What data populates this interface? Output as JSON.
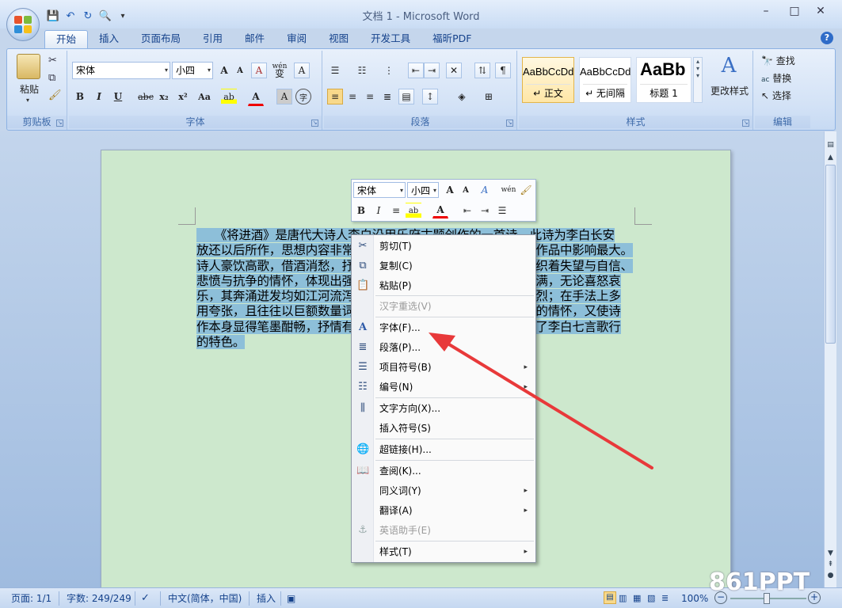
{
  "window": {
    "title": "文档 1 - Microsoft Word",
    "minimize": "–",
    "maximize": "□",
    "close": "✕"
  },
  "qat": {
    "save": "💾",
    "undo": "↶",
    "redo": "↻",
    "preview": "🔍",
    "customize": "▾"
  },
  "tabs": [
    "开始",
    "插入",
    "页面布局",
    "引用",
    "邮件",
    "审阅",
    "视图",
    "开发工具",
    "福昕PDF"
  ],
  "help": "?",
  "ribbon": {
    "clipboard": {
      "label": "剪贴板",
      "paste": "粘贴"
    },
    "font": {
      "label": "字体",
      "font_name": "宋体",
      "font_size": "小四",
      "bold": "B",
      "italic": "I",
      "underline": "U",
      "strike": "abc",
      "sub": "x₂",
      "sup": "x²",
      "case": "Aa",
      "highlight": "ab",
      "color": "A",
      "grow": "A",
      "shrink": "A",
      "clear": "A",
      "phonetic": "wén",
      "phonetic2": "变",
      "border": "A",
      "enclose": "字"
    },
    "paragraph": {
      "label": "段落"
    },
    "styles": {
      "label": "样式",
      "items": [
        {
          "preview": "AaBbCcDd",
          "name": "↵ 正文"
        },
        {
          "preview": "AaBbCcDd",
          "name": "↵ 无间隔"
        },
        {
          "preview": "AaBb",
          "name": "标题 1"
        }
      ],
      "change": "更改样式"
    },
    "editing": {
      "label": "编辑",
      "find": "查找",
      "replace": "替换",
      "select": "选择"
    }
  },
  "document": {
    "lines": [
      "　　《将进酒》是唐代大诗人李白沿用乐府古题创作的一首诗。此诗为李白长安",
      "放还以后所作，思想内容非常深沉，艺术表现非常成熟，在同类作品中影响最大。",
      "诗人豪饮高歌，借酒消愁，抒发了忧愤深广的人生感慨。诗中交织着失望与自信、",
      "悲愤与抗争的情怀，体现出强烈的豪纵狂放的个性。全诗情感饱满，无论喜怒哀",
      "乐，其奔涌迸发均如江河流泻，不可遏止，且起伏跌宕，变化剧烈；在手法上多",
      "用夸张，且往往以巨额数量词进行修饰，既表现出诗人豪迈洒脱的情怀，又使诗",
      "作本身显得笔墨酣畅，抒情有力；在结构上大开大阖，充分体现了李白七言歌行",
      "的特色。"
    ]
  },
  "mini_toolbar": {
    "font_name": "宋体",
    "font_size": "小四",
    "bold": "B",
    "italic": "I",
    "color": "A"
  },
  "context_menu": {
    "items": [
      {
        "label": "剪切(T)",
        "icon": "scissors-icon",
        "glyph": "✂",
        "disabled": false,
        "submenu": false
      },
      {
        "label": "复制(C)",
        "icon": "copy-icon",
        "glyph": "⧉",
        "disabled": false,
        "submenu": false
      },
      {
        "label": "粘贴(P)",
        "icon": "paste-icon",
        "glyph": "📋",
        "disabled": false,
        "submenu": false
      },
      {
        "label": "汉字重选(V)",
        "icon": "",
        "glyph": "",
        "disabled": true,
        "submenu": false
      },
      {
        "label": "字体(F)...",
        "icon": "font-icon",
        "glyph": "A",
        "disabled": false,
        "submenu": false
      },
      {
        "label": "段落(P)...",
        "icon": "paragraph-icon",
        "glyph": "≣",
        "disabled": false,
        "submenu": false
      },
      {
        "label": "项目符号(B)",
        "icon": "bullets-icon",
        "glyph": "☰",
        "disabled": false,
        "submenu": true
      },
      {
        "label": "编号(N)",
        "icon": "numbering-icon",
        "glyph": "☷",
        "disabled": false,
        "submenu": true
      },
      {
        "label": "文字方向(X)...",
        "icon": "text-direction-icon",
        "glyph": "⫼",
        "disabled": false,
        "submenu": false
      },
      {
        "label": "插入符号(S)",
        "icon": "",
        "glyph": "",
        "disabled": false,
        "submenu": false
      },
      {
        "label": "超链接(H)...",
        "icon": "hyperlink-icon",
        "glyph": "🌐",
        "disabled": false,
        "submenu": false
      },
      {
        "label": "查阅(K)...",
        "icon": "research-icon",
        "glyph": "📖",
        "disabled": false,
        "submenu": false
      },
      {
        "label": "同义词(Y)",
        "icon": "",
        "glyph": "",
        "disabled": false,
        "submenu": true
      },
      {
        "label": "翻译(A)",
        "icon": "",
        "glyph": "",
        "disabled": false,
        "submenu": true
      },
      {
        "label": "英语助手(E)",
        "icon": "english-assistant-icon",
        "glyph": "⚓",
        "disabled": true,
        "submenu": false
      },
      {
        "label": "样式(T)",
        "icon": "",
        "glyph": "",
        "disabled": false,
        "submenu": true
      }
    ],
    "submenu_arrow": "▸"
  },
  "status": {
    "page": "页面: 1/1",
    "words": "字数: 249/249",
    "language": "中文(简体，中国)",
    "mode": "插入",
    "zoom": "100%",
    "zoom_out": "−",
    "zoom_in": "+"
  },
  "watermark": "861PPT",
  "colors": {
    "accent": "#15428b",
    "selection": "#8dbfd9",
    "page": "#cde8cd",
    "arrow": "#e8393a"
  }
}
